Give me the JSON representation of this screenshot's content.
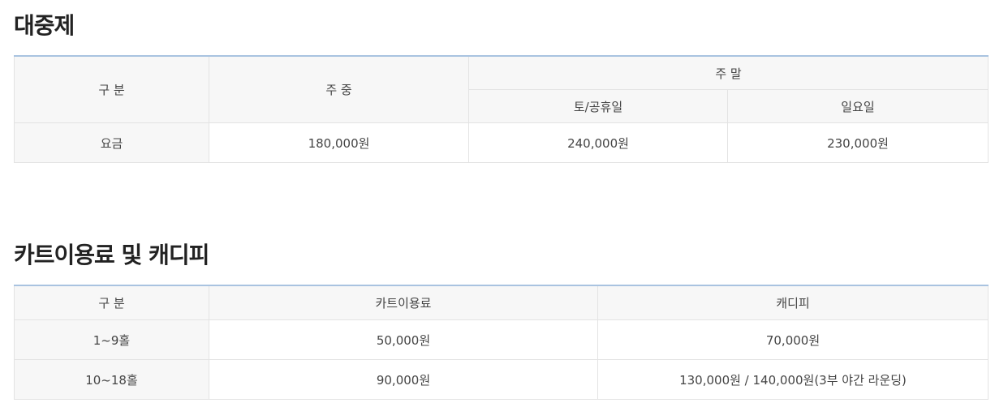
{
  "section1": {
    "title": "대중제",
    "table": {
      "header": {
        "category": "구 분",
        "weekday": "주 중",
        "weekend": "주 말",
        "saturday_holiday": "토/공휴일",
        "sunday": "일요일"
      },
      "row": {
        "label": "요금",
        "weekday": "180,000원",
        "saturday_holiday": "240,000원",
        "sunday": "230,000원"
      }
    }
  },
  "section2": {
    "title": "카트이용료 및 캐디피",
    "table": {
      "header": {
        "category": "구 분",
        "cart": "카트이용료",
        "caddie": "캐디피"
      },
      "rows": [
        {
          "label": "1~9홀",
          "cart": "50,000원",
          "caddie": "70,000원"
        },
        {
          "label": "10~18홀",
          "cart": "90,000원",
          "caddie": "130,000원 / 140,000원(3부 야간 라운딩)"
        }
      ]
    }
  },
  "colors": {
    "table_top_border": "#a9c3e0",
    "header_background": "#f7f7f7",
    "cell_border": "#e3e3e3"
  }
}
